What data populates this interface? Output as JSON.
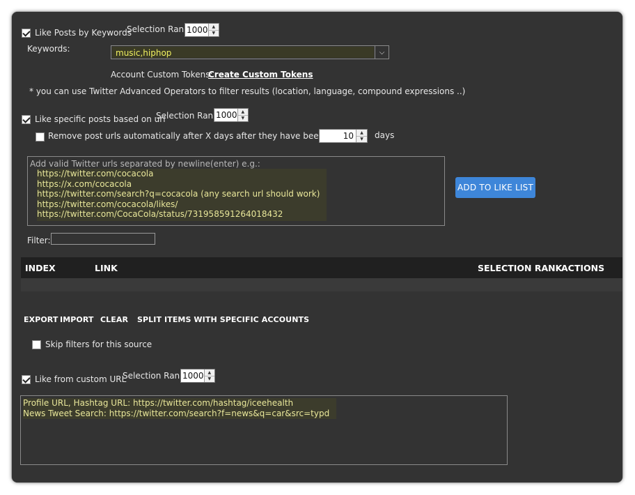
{
  "keywords_section": {
    "checkbox_label": "Like Posts by Keywords",
    "checked": true,
    "rank_label": "Selection Rank",
    "rank_value": "1000",
    "keywords_label": "Keywords:",
    "keywords_value": "music,hiphop",
    "tokens_label": "Account Custom Tokens:",
    "tokens_link": "Create Custom Tokens",
    "note": "* you can use Twitter Advanced Operators to filter results (location, language, compound expressions ..)"
  },
  "url_section": {
    "checkbox_label": "Like specific posts based on url",
    "checked": true,
    "rank_label": "Selection Rank",
    "rank_value": "1000",
    "remove_label": "Remove post urls automatically after X days after they have been added",
    "remove_checked": false,
    "days_value": "10",
    "days_label": "days",
    "textarea_placeholder": "Add valid Twitter urls separated by newline(enter) e.g.:",
    "example_urls": [
      "https://twitter.com/cocacola",
      "https://x.com/cocacola",
      "https://twitter.com/search?q=cocacola (any search url should work)",
      "https://twitter.com/cocacola/likes/",
      "https://twitter.com/CocaCola/status/731958591264018432"
    ],
    "add_button": "ADD TO LIKE LIST",
    "filter_label": "Filter:",
    "table_headers": [
      "INDEX",
      "LINK",
      "SELECTION RANK",
      "ACTIONS"
    ],
    "actions": [
      "EXPORT",
      "IMPORT",
      "CLEAR",
      "SPLIT ITEMS WITH SPECIFIC ACCOUNTS"
    ],
    "skip_filters_label": "Skip filters for this source",
    "skip_filters_checked": false
  },
  "custom_url_section": {
    "checkbox_label": "Like from custom URL",
    "checked": true,
    "rank_label": "Selection Rank",
    "rank_value": "1000",
    "hint_lines": [
      "Profile URL, Hashtag URL: https://twitter.com/hashtag/iceehealth",
      "News Tweet Search:  https://twitter.com/search?f=news&q=car&src=typd"
    ]
  }
}
